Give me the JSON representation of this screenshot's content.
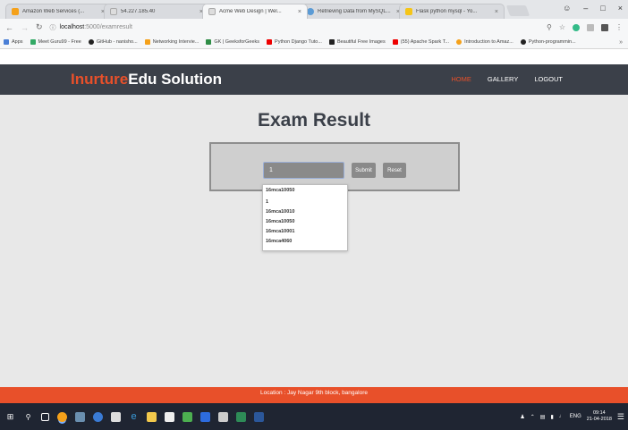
{
  "browser": {
    "tabs": [
      {
        "title": "Amazon Web Services (...",
        "favicon_color": "#f5a11a"
      },
      {
        "title": "54.227.185.40",
        "favicon_color": "#cccccc"
      },
      {
        "title": "Acme Web Design | Wel...",
        "favicon_color": "#cccccc",
        "active": true
      },
      {
        "title": "Retrieving Data from MySQL...",
        "favicon_color": "#5b9bd5"
      },
      {
        "title": "Flask python mysql - Yo...",
        "favicon_color": "#f5c518"
      }
    ],
    "window_controls": {
      "minimize": "–",
      "maximize": "□",
      "close": "×"
    },
    "profile_icon": "user-icon",
    "url_host": "localhost",
    "url_path": ":5000/examresult",
    "bookmarks": [
      {
        "label": "Apps",
        "color": "#4a7fd6"
      },
      {
        "label": "Meet Guru99 - Free",
        "color": "#3a6"
      },
      {
        "label": "GitHub - nanisho...",
        "color": "#222"
      },
      {
        "label": "Networking Intervie...",
        "color": "#f5a11a"
      },
      {
        "label": "GK | GeeksforGeeks",
        "color": "#2f8d46"
      },
      {
        "label": "Python Django Tuto...",
        "color": "#e00"
      },
      {
        "label": "Beautiful Free Images",
        "color": "#222"
      },
      {
        "label": "(55) Apache Spark T...",
        "color": "#e00"
      },
      {
        "label": "Introduction to Amaz...",
        "color": "#f5a11a"
      },
      {
        "label": "Python-programmin...",
        "color": "#222"
      }
    ]
  },
  "site": {
    "brand_part1": "Inurture",
    "brand_part2": "Edu Solution",
    "nav": [
      {
        "label": "HOME",
        "active": true
      },
      {
        "label": "GALLERY",
        "active": false
      },
      {
        "label": "LOGOUT",
        "active": false
      }
    ],
    "colors": {
      "accent": "#e8502a",
      "header_bg": "#3b4049",
      "content_bg": "#e8e8e8"
    }
  },
  "exam_form": {
    "title": "Exam Result",
    "input_value": "1",
    "submit_label": "Submit",
    "reset_label": "Reset",
    "suggestions": [
      "16mca10050",
      "1",
      "16mca10010",
      "16mca10050",
      "16mca10001",
      "16mca4060"
    ]
  },
  "footer": {
    "location_text": "Location : Jay Nagar 9th block, bangalore"
  },
  "taskbar": {
    "language": "ENG",
    "time": "09:14",
    "date": "21-04-2018"
  }
}
